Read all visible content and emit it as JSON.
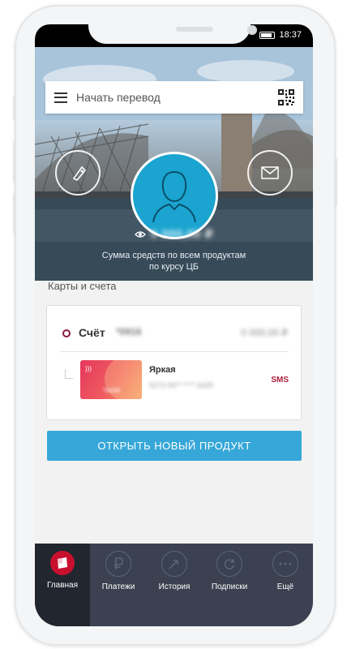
{
  "status_bar": {
    "time": "18:37"
  },
  "search": {
    "placeholder": "Начать перевод"
  },
  "hero": {
    "balance": "5 000,00 ₽",
    "caption_line1": "Сумма средств по всем продуктам",
    "caption_line2": "по курсу ЦБ"
  },
  "cards_section": {
    "title": "Карты и счета",
    "account": {
      "label": "Счёт",
      "number": "*0916",
      "amount": "0 000,00 ₽"
    },
    "card": {
      "name": "Яркая",
      "number_masked": "5272 69** **** 6439",
      "card_face_number": "*6439",
      "sms_label": "SMS"
    }
  },
  "open_product_button": "ОТКРЫТЬ НОВЫЙ ПРОДУКТ",
  "tabbar": {
    "items": [
      {
        "label": "Главная",
        "icon": "bank-logo-icon",
        "active": true
      },
      {
        "label": "Платежи",
        "icon": "ruble-icon",
        "active": false
      },
      {
        "label": "История",
        "icon": "transfer-arrows-icon",
        "active": false
      },
      {
        "label": "Подписки",
        "icon": "refresh-icon",
        "active": false
      },
      {
        "label": "Ещё",
        "icon": "more-dots-icon",
        "active": false
      }
    ]
  },
  "colors": {
    "accent": "#36a7d8",
    "avatar": "#1aa4cf",
    "tabbar": "#3b4150",
    "brand_red": "#b2203c"
  }
}
